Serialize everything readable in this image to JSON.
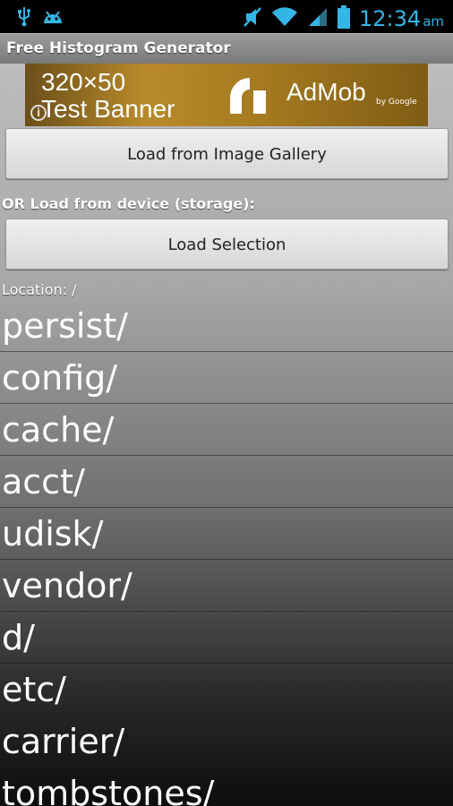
{
  "status_bar": {
    "time": "12:34",
    "ampm": "am"
  },
  "app": {
    "title": "Free Histogram Generator"
  },
  "ad": {
    "banner_text": "320x50 Test Banner",
    "banner_line1": "320×50",
    "banner_line2": "Test Banner",
    "brand": "AdMob",
    "by": "by Google"
  },
  "buttons": {
    "gallery": "Load from Image Gallery",
    "load_selection": "Load Selection"
  },
  "or_label": "OR Load from device (storage):",
  "location_label": "Location: /",
  "files": [
    "persist/",
    "config/",
    "cache/",
    "acct/",
    "udisk/",
    "vendor/",
    "d/",
    "etc/",
    "carrier/",
    "tombstones/"
  ]
}
